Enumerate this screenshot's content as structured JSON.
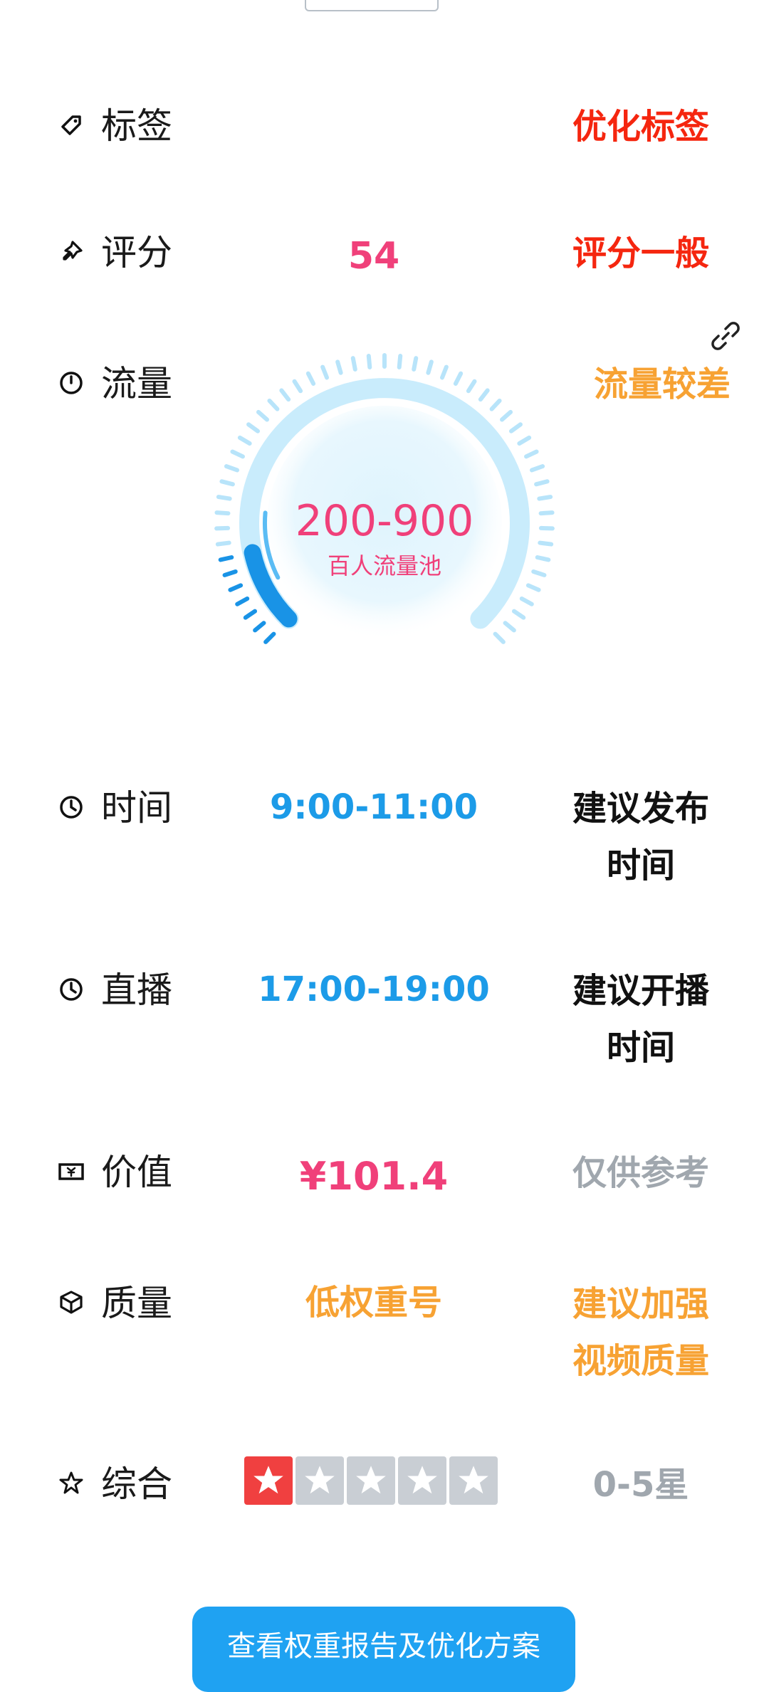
{
  "rows": {
    "tag": {
      "label": "标签",
      "right": "优化标签",
      "icon": "tag-icon"
    },
    "score": {
      "label": "评分",
      "value": "54",
      "right": "评分一般",
      "icon": "pin-icon"
    },
    "traffic": {
      "label": "流量",
      "right": "流量较差",
      "icon": "gauge-icon",
      "gauge": {
        "range": "200-900",
        "unit": "百人流量池",
        "level": 0.12
      }
    },
    "time": {
      "label": "时间",
      "value": "9:00-11:00",
      "right_line1": "建议发布",
      "right_line2": "时间",
      "icon": "clock-icon"
    },
    "live": {
      "label": "直播",
      "value": "17:00-19:00",
      "right_line1": "建议开播",
      "right_line2": "时间",
      "icon": "clock-icon"
    },
    "value": {
      "label": "价值",
      "value": "¥101.4",
      "right": "仅供参考",
      "icon": "ticket-icon"
    },
    "quality": {
      "label": "质量",
      "value": "低权重号",
      "right_line1": "建议加强",
      "right_line2": "视频质量",
      "icon": "cube-icon"
    },
    "overall": {
      "label": "综合",
      "stars_filled": 1,
      "stars_total": 5,
      "right": "0-5星",
      "icon": "star-outline-icon"
    }
  },
  "cta_label": "查看权重报告及优化方案",
  "colors": {
    "red": "#f5260f",
    "pink": "#f0407a",
    "blue": "#1c9be8",
    "orange": "#f7a233",
    "gray": "#a0a7ae",
    "cta": "#1fa2f2",
    "star_active": "#f04040",
    "star_inactive": "#c9ced4"
  }
}
